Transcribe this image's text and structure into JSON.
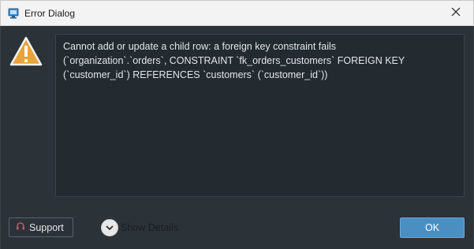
{
  "window": {
    "title": "Error Dialog",
    "app_icon": "database-app-icon",
    "close_icon": "close-icon"
  },
  "message": {
    "icon": "warning-icon",
    "text": "Cannot add or update a child row: a foreign key constraint fails\n(`organization`.`orders`, CONSTRAINT `fk_orders_customers` FOREIGN KEY\n(`customer_id`) REFERENCES `customers` (`customer_id`))"
  },
  "footer": {
    "support_label": "Support",
    "support_icon": "headset-icon",
    "details_label": "Show Details",
    "details_icon": "chevron-down-icon",
    "ok_label": "OK"
  },
  "colors": {
    "background": "#2b3238",
    "message_background": "#232a30",
    "accent": "#4a8ec2",
    "warning": "#e8a33c"
  }
}
